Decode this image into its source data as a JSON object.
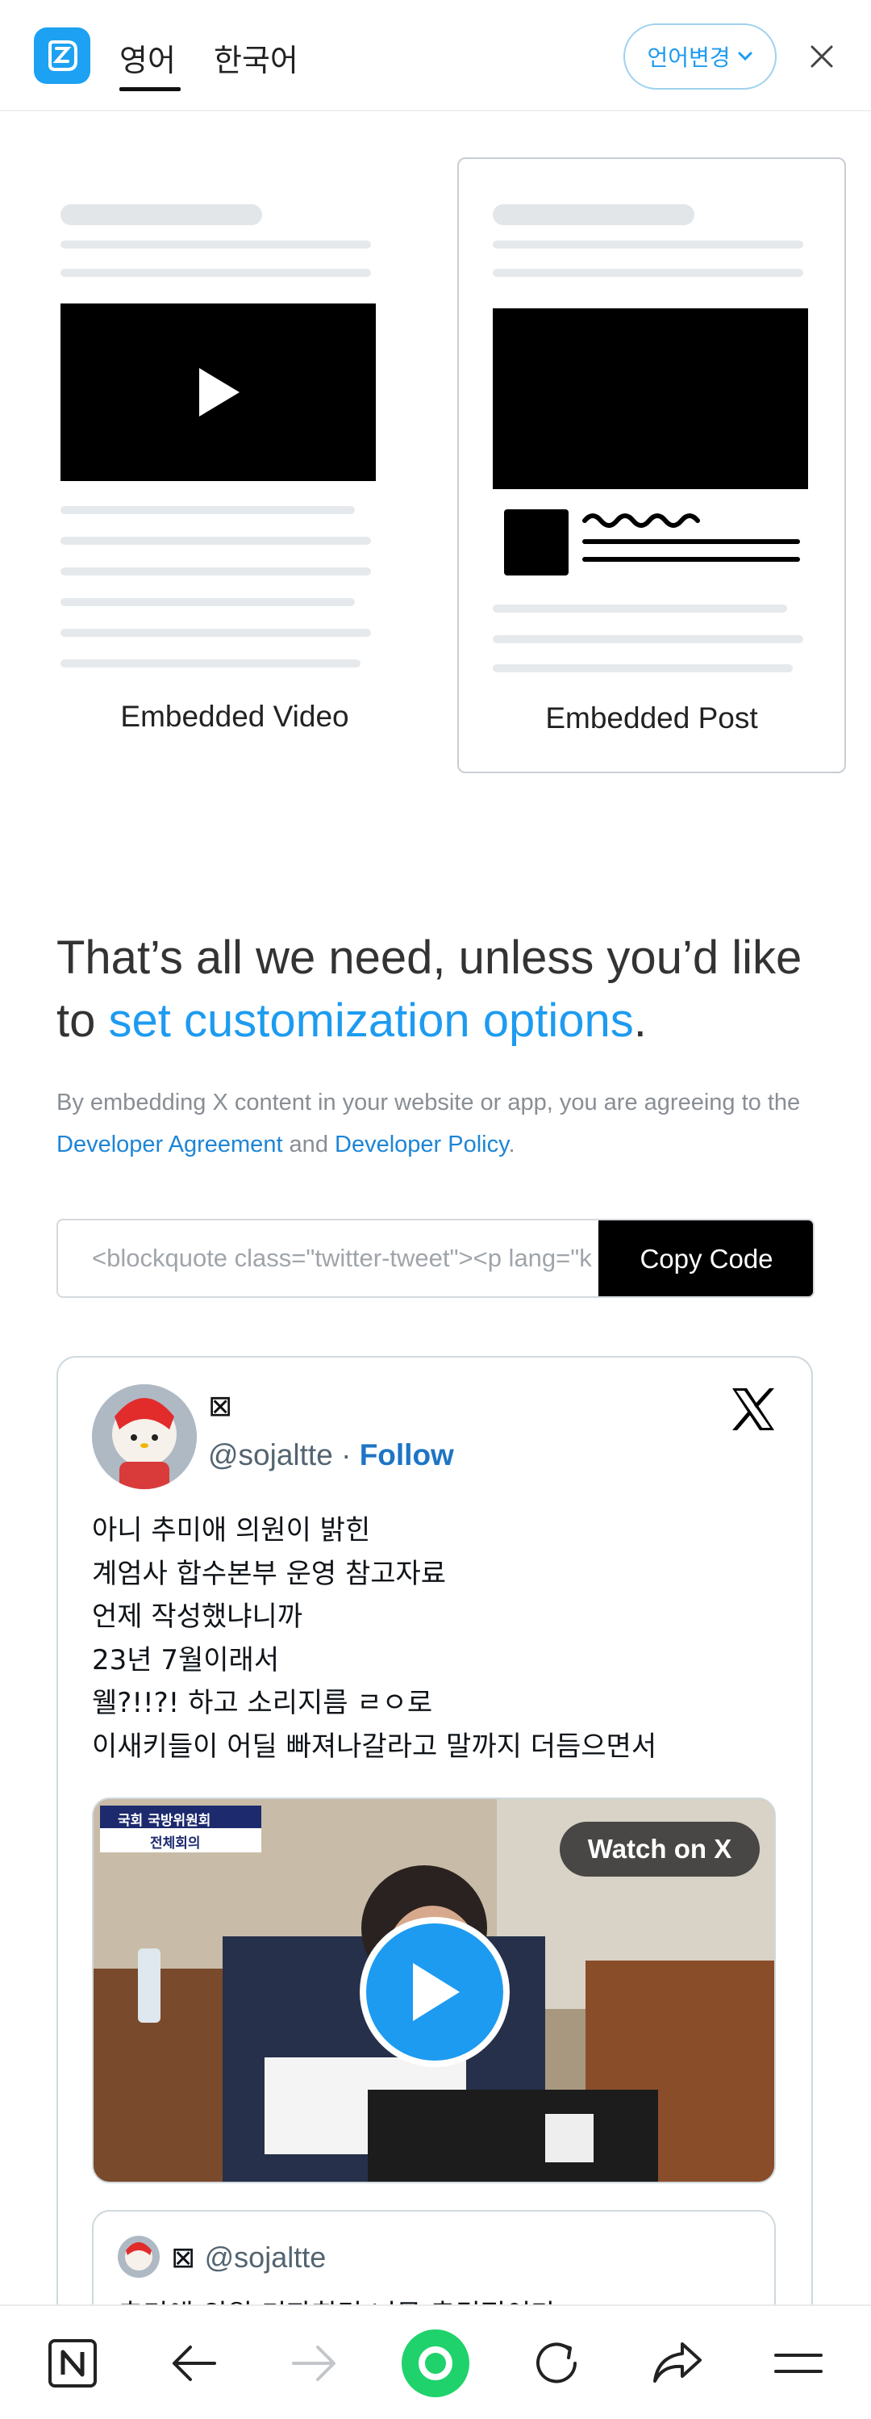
{
  "header": {
    "tabs": [
      {
        "label": "영어",
        "active": true
      },
      {
        "label": "한국어",
        "active": false
      }
    ],
    "language_button": "언어변경",
    "icons": {
      "app": "app-logo-icon",
      "close": "close-icon",
      "dropdown": "chevron-down-icon"
    }
  },
  "options": {
    "video_label": "Embedded Video",
    "post_label": "Embedded Post",
    "selected": "Embedded Post"
  },
  "info": {
    "headline_prefix": "That’s all we need, unless you’d like to ",
    "headline_link": "set customization options",
    "headline_suffix": ".",
    "agreement_prefix": "By embedding X content in your website or app, you are agreeing to the ",
    "agreement_link1": "Developer Agreement",
    "agreement_middle": " and ",
    "agreement_link2": "Developer Policy",
    "agreement_suffix": "."
  },
  "code": {
    "value": "<blockquote class=\"twitter-tweet\"><p lang=\"ko\" dir=\"ltr\">",
    "copy_label": "Copy Code"
  },
  "tweet": {
    "name": "⊠",
    "handle": "@sojaltte",
    "separator": " · ",
    "follow_label": "Follow",
    "lines": [
      "아니 추미애 의원이 밝힌",
      "계엄사 합수본부 운영 참고자료",
      "언제 작성했냐니까",
      "23년 7월이래서",
      "웰?!!?! 하고 소리지름 ㄹㅇ로",
      "이새키들이 어딜 빠져나갈라고 말까지 더듬으면서"
    ],
    "media": {
      "watch_label": "Watch on X",
      "caption_top": "국회 국방위원회",
      "caption_bottom": "전체회의"
    },
    "quote": {
      "name": "⊠",
      "handle": "@sojaltte",
      "text": "추미애 의원 기자회견 너무 충격적이다"
    }
  },
  "bottom_nav": {
    "icons": [
      "notion-icon",
      "back-arrow-icon",
      "forward-arrow-icon",
      "home-record-icon",
      "refresh-icon",
      "share-icon",
      "menu-icon"
    ]
  },
  "colors": {
    "accent": "#1d9bf0",
    "nav_green": "#1fd26b"
  }
}
